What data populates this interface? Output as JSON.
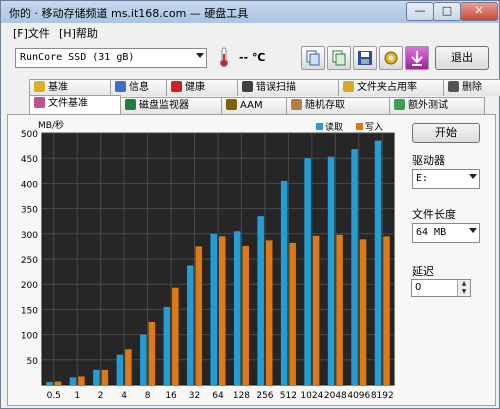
{
  "window": {
    "title": "你的 · 移动存储频道 ms.it168.com — 硬盘工具",
    "minimize": "—",
    "maximize": "□",
    "close": "✕"
  },
  "menu": {
    "file": "[F]文件",
    "help": "[H]帮助"
  },
  "toolbar": {
    "drive_combo": "RunCore SSD (31 gB)",
    "temperature": "-- ℃",
    "exit_label": "退出"
  },
  "tabs_row1": [
    {
      "label": "基准",
      "color": "#d8b020"
    },
    {
      "label": "信息",
      "color": "#3a6fd0"
    },
    {
      "label": "健康",
      "color": "#d02020"
    },
    {
      "label": "错误扫描",
      "color": "#404040"
    },
    {
      "label": "文件夹占用率",
      "color": "#d8a820"
    },
    {
      "label": "删除",
      "color": "#555555"
    }
  ],
  "tabs_row2": [
    {
      "label": "文件基准",
      "color": "#c05090",
      "active": true
    },
    {
      "label": "磁盘监视器",
      "color": "#208040",
      "active": false
    },
    {
      "label": "AAM",
      "color": "#806000",
      "active": false
    },
    {
      "label": "随机存取",
      "color": "#b08040",
      "active": false
    },
    {
      "label": "额外测试",
      "color": "#40a050",
      "active": false
    }
  ],
  "side": {
    "start_button": "开始",
    "drive_label": "驱动器",
    "drive_value": "E:",
    "file_length_label": "文件长度",
    "file_length_value": "64 MB",
    "delay_label": "延迟",
    "delay_value": "0"
  },
  "colors": {
    "read": "#1f9fd6",
    "write": "#e07a10",
    "plot_bg": "#262626",
    "grid": "#4a4a4a"
  },
  "chart_data": {
    "type": "bar",
    "ylabel": "MB/秒",
    "ylim": [
      0,
      500
    ],
    "yticks": [
      50,
      100,
      150,
      200,
      250,
      300,
      350,
      400,
      450,
      500
    ],
    "categories": [
      "0.5",
      "1",
      "2",
      "4",
      "8",
      "16",
      "32",
      "64",
      "128",
      "256",
      "512",
      "1024",
      "2048",
      "4096",
      "8192"
    ],
    "legend_position": "top-right",
    "series": [
      {
        "name": "读取",
        "color": "#1f9fd6",
        "values": [
          6,
          15,
          30,
          60,
          100,
          155,
          237,
          300,
          305,
          335,
          405,
          450,
          453,
          468,
          485
        ]
      },
      {
        "name": "写入",
        "color": "#e07a10",
        "values": [
          7,
          17,
          30,
          71,
          125,
          193,
          275,
          295,
          276,
          287,
          282,
          296,
          298,
          289,
          295
        ]
      }
    ]
  }
}
